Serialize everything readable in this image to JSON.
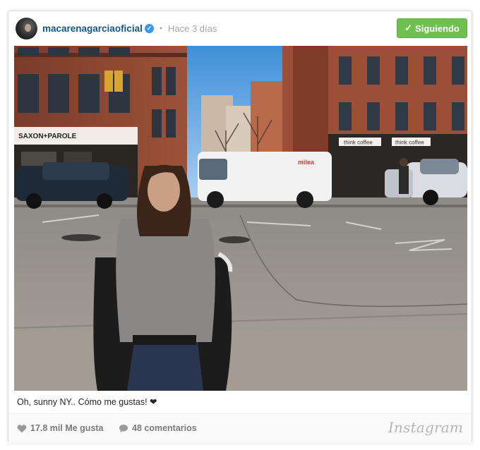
{
  "post": {
    "username": "macarenagarciaoficial",
    "verified_symbol": "✓",
    "separator": "•",
    "time": "Hace 3 días",
    "follow_button": "Siguiendo",
    "follow_check": "✓",
    "caption": "Oh, sunny NY.. Cómo me gustas! ❤",
    "likes": "17.8 mil Me gusta",
    "comments": "48 comentarios",
    "brand": "Instagram"
  },
  "photo": {
    "signs": {
      "store": "SAXON+PAROLE",
      "van": "milea",
      "cafe_left": "think coffee",
      "cafe_right": "think coffee"
    }
  },
  "colors": {
    "username": "#125688",
    "follow_button": "#70c050",
    "verified": "#3897f0",
    "sky": "#5aa9e6"
  },
  "icons": {
    "like": "heart-icon",
    "comment": "comment-bubble-icon",
    "verified": "verified-badge-icon"
  }
}
